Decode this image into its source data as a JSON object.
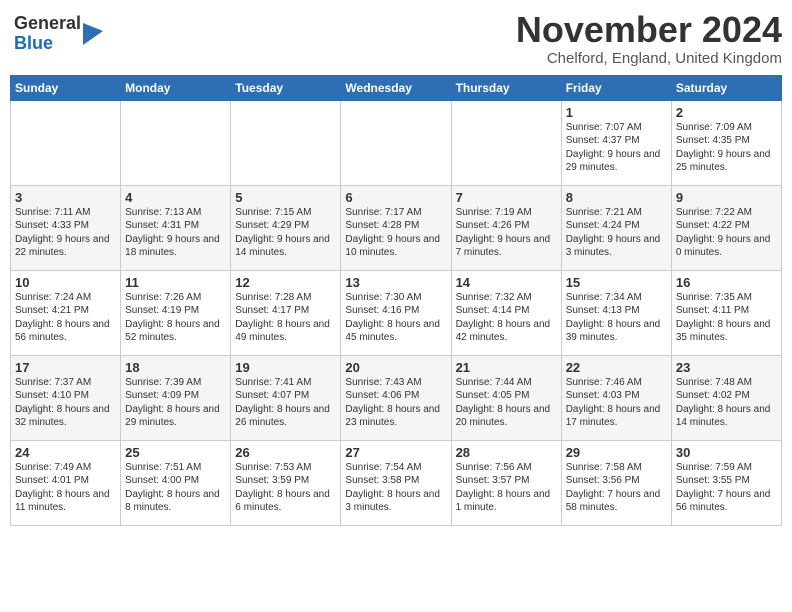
{
  "header": {
    "logo_general": "General",
    "logo_blue": "Blue",
    "month_title": "November 2024",
    "location": "Chelford, England, United Kingdom"
  },
  "weekdays": [
    "Sunday",
    "Monday",
    "Tuesday",
    "Wednesday",
    "Thursday",
    "Friday",
    "Saturday"
  ],
  "weeks": [
    [
      {
        "day": "",
        "info": ""
      },
      {
        "day": "",
        "info": ""
      },
      {
        "day": "",
        "info": ""
      },
      {
        "day": "",
        "info": ""
      },
      {
        "day": "",
        "info": ""
      },
      {
        "day": "1",
        "info": "Sunrise: 7:07 AM\nSunset: 4:37 PM\nDaylight: 9 hours and 29 minutes."
      },
      {
        "day": "2",
        "info": "Sunrise: 7:09 AM\nSunset: 4:35 PM\nDaylight: 9 hours and 25 minutes."
      }
    ],
    [
      {
        "day": "3",
        "info": "Sunrise: 7:11 AM\nSunset: 4:33 PM\nDaylight: 9 hours and 22 minutes."
      },
      {
        "day": "4",
        "info": "Sunrise: 7:13 AM\nSunset: 4:31 PM\nDaylight: 9 hours and 18 minutes."
      },
      {
        "day": "5",
        "info": "Sunrise: 7:15 AM\nSunset: 4:29 PM\nDaylight: 9 hours and 14 minutes."
      },
      {
        "day": "6",
        "info": "Sunrise: 7:17 AM\nSunset: 4:28 PM\nDaylight: 9 hours and 10 minutes."
      },
      {
        "day": "7",
        "info": "Sunrise: 7:19 AM\nSunset: 4:26 PM\nDaylight: 9 hours and 7 minutes."
      },
      {
        "day": "8",
        "info": "Sunrise: 7:21 AM\nSunset: 4:24 PM\nDaylight: 9 hours and 3 minutes."
      },
      {
        "day": "9",
        "info": "Sunrise: 7:22 AM\nSunset: 4:22 PM\nDaylight: 9 hours and 0 minutes."
      }
    ],
    [
      {
        "day": "10",
        "info": "Sunrise: 7:24 AM\nSunset: 4:21 PM\nDaylight: 8 hours and 56 minutes."
      },
      {
        "day": "11",
        "info": "Sunrise: 7:26 AM\nSunset: 4:19 PM\nDaylight: 8 hours and 52 minutes."
      },
      {
        "day": "12",
        "info": "Sunrise: 7:28 AM\nSunset: 4:17 PM\nDaylight: 8 hours and 49 minutes."
      },
      {
        "day": "13",
        "info": "Sunrise: 7:30 AM\nSunset: 4:16 PM\nDaylight: 8 hours and 45 minutes."
      },
      {
        "day": "14",
        "info": "Sunrise: 7:32 AM\nSunset: 4:14 PM\nDaylight: 8 hours and 42 minutes."
      },
      {
        "day": "15",
        "info": "Sunrise: 7:34 AM\nSunset: 4:13 PM\nDaylight: 8 hours and 39 minutes."
      },
      {
        "day": "16",
        "info": "Sunrise: 7:35 AM\nSunset: 4:11 PM\nDaylight: 8 hours and 35 minutes."
      }
    ],
    [
      {
        "day": "17",
        "info": "Sunrise: 7:37 AM\nSunset: 4:10 PM\nDaylight: 8 hours and 32 minutes."
      },
      {
        "day": "18",
        "info": "Sunrise: 7:39 AM\nSunset: 4:09 PM\nDaylight: 8 hours and 29 minutes."
      },
      {
        "day": "19",
        "info": "Sunrise: 7:41 AM\nSunset: 4:07 PM\nDaylight: 8 hours and 26 minutes."
      },
      {
        "day": "20",
        "info": "Sunrise: 7:43 AM\nSunset: 4:06 PM\nDaylight: 8 hours and 23 minutes."
      },
      {
        "day": "21",
        "info": "Sunrise: 7:44 AM\nSunset: 4:05 PM\nDaylight: 8 hours and 20 minutes."
      },
      {
        "day": "22",
        "info": "Sunrise: 7:46 AM\nSunset: 4:03 PM\nDaylight: 8 hours and 17 minutes."
      },
      {
        "day": "23",
        "info": "Sunrise: 7:48 AM\nSunset: 4:02 PM\nDaylight: 8 hours and 14 minutes."
      }
    ],
    [
      {
        "day": "24",
        "info": "Sunrise: 7:49 AM\nSunset: 4:01 PM\nDaylight: 8 hours and 11 minutes."
      },
      {
        "day": "25",
        "info": "Sunrise: 7:51 AM\nSunset: 4:00 PM\nDaylight: 8 hours and 8 minutes."
      },
      {
        "day": "26",
        "info": "Sunrise: 7:53 AM\nSunset: 3:59 PM\nDaylight: 8 hours and 6 minutes."
      },
      {
        "day": "27",
        "info": "Sunrise: 7:54 AM\nSunset: 3:58 PM\nDaylight: 8 hours and 3 minutes."
      },
      {
        "day": "28",
        "info": "Sunrise: 7:56 AM\nSunset: 3:57 PM\nDaylight: 8 hours and 1 minute."
      },
      {
        "day": "29",
        "info": "Sunrise: 7:58 AM\nSunset: 3:56 PM\nDaylight: 7 hours and 58 minutes."
      },
      {
        "day": "30",
        "info": "Sunrise: 7:59 AM\nSunset: 3:55 PM\nDaylight: 7 hours and 56 minutes."
      }
    ]
  ]
}
